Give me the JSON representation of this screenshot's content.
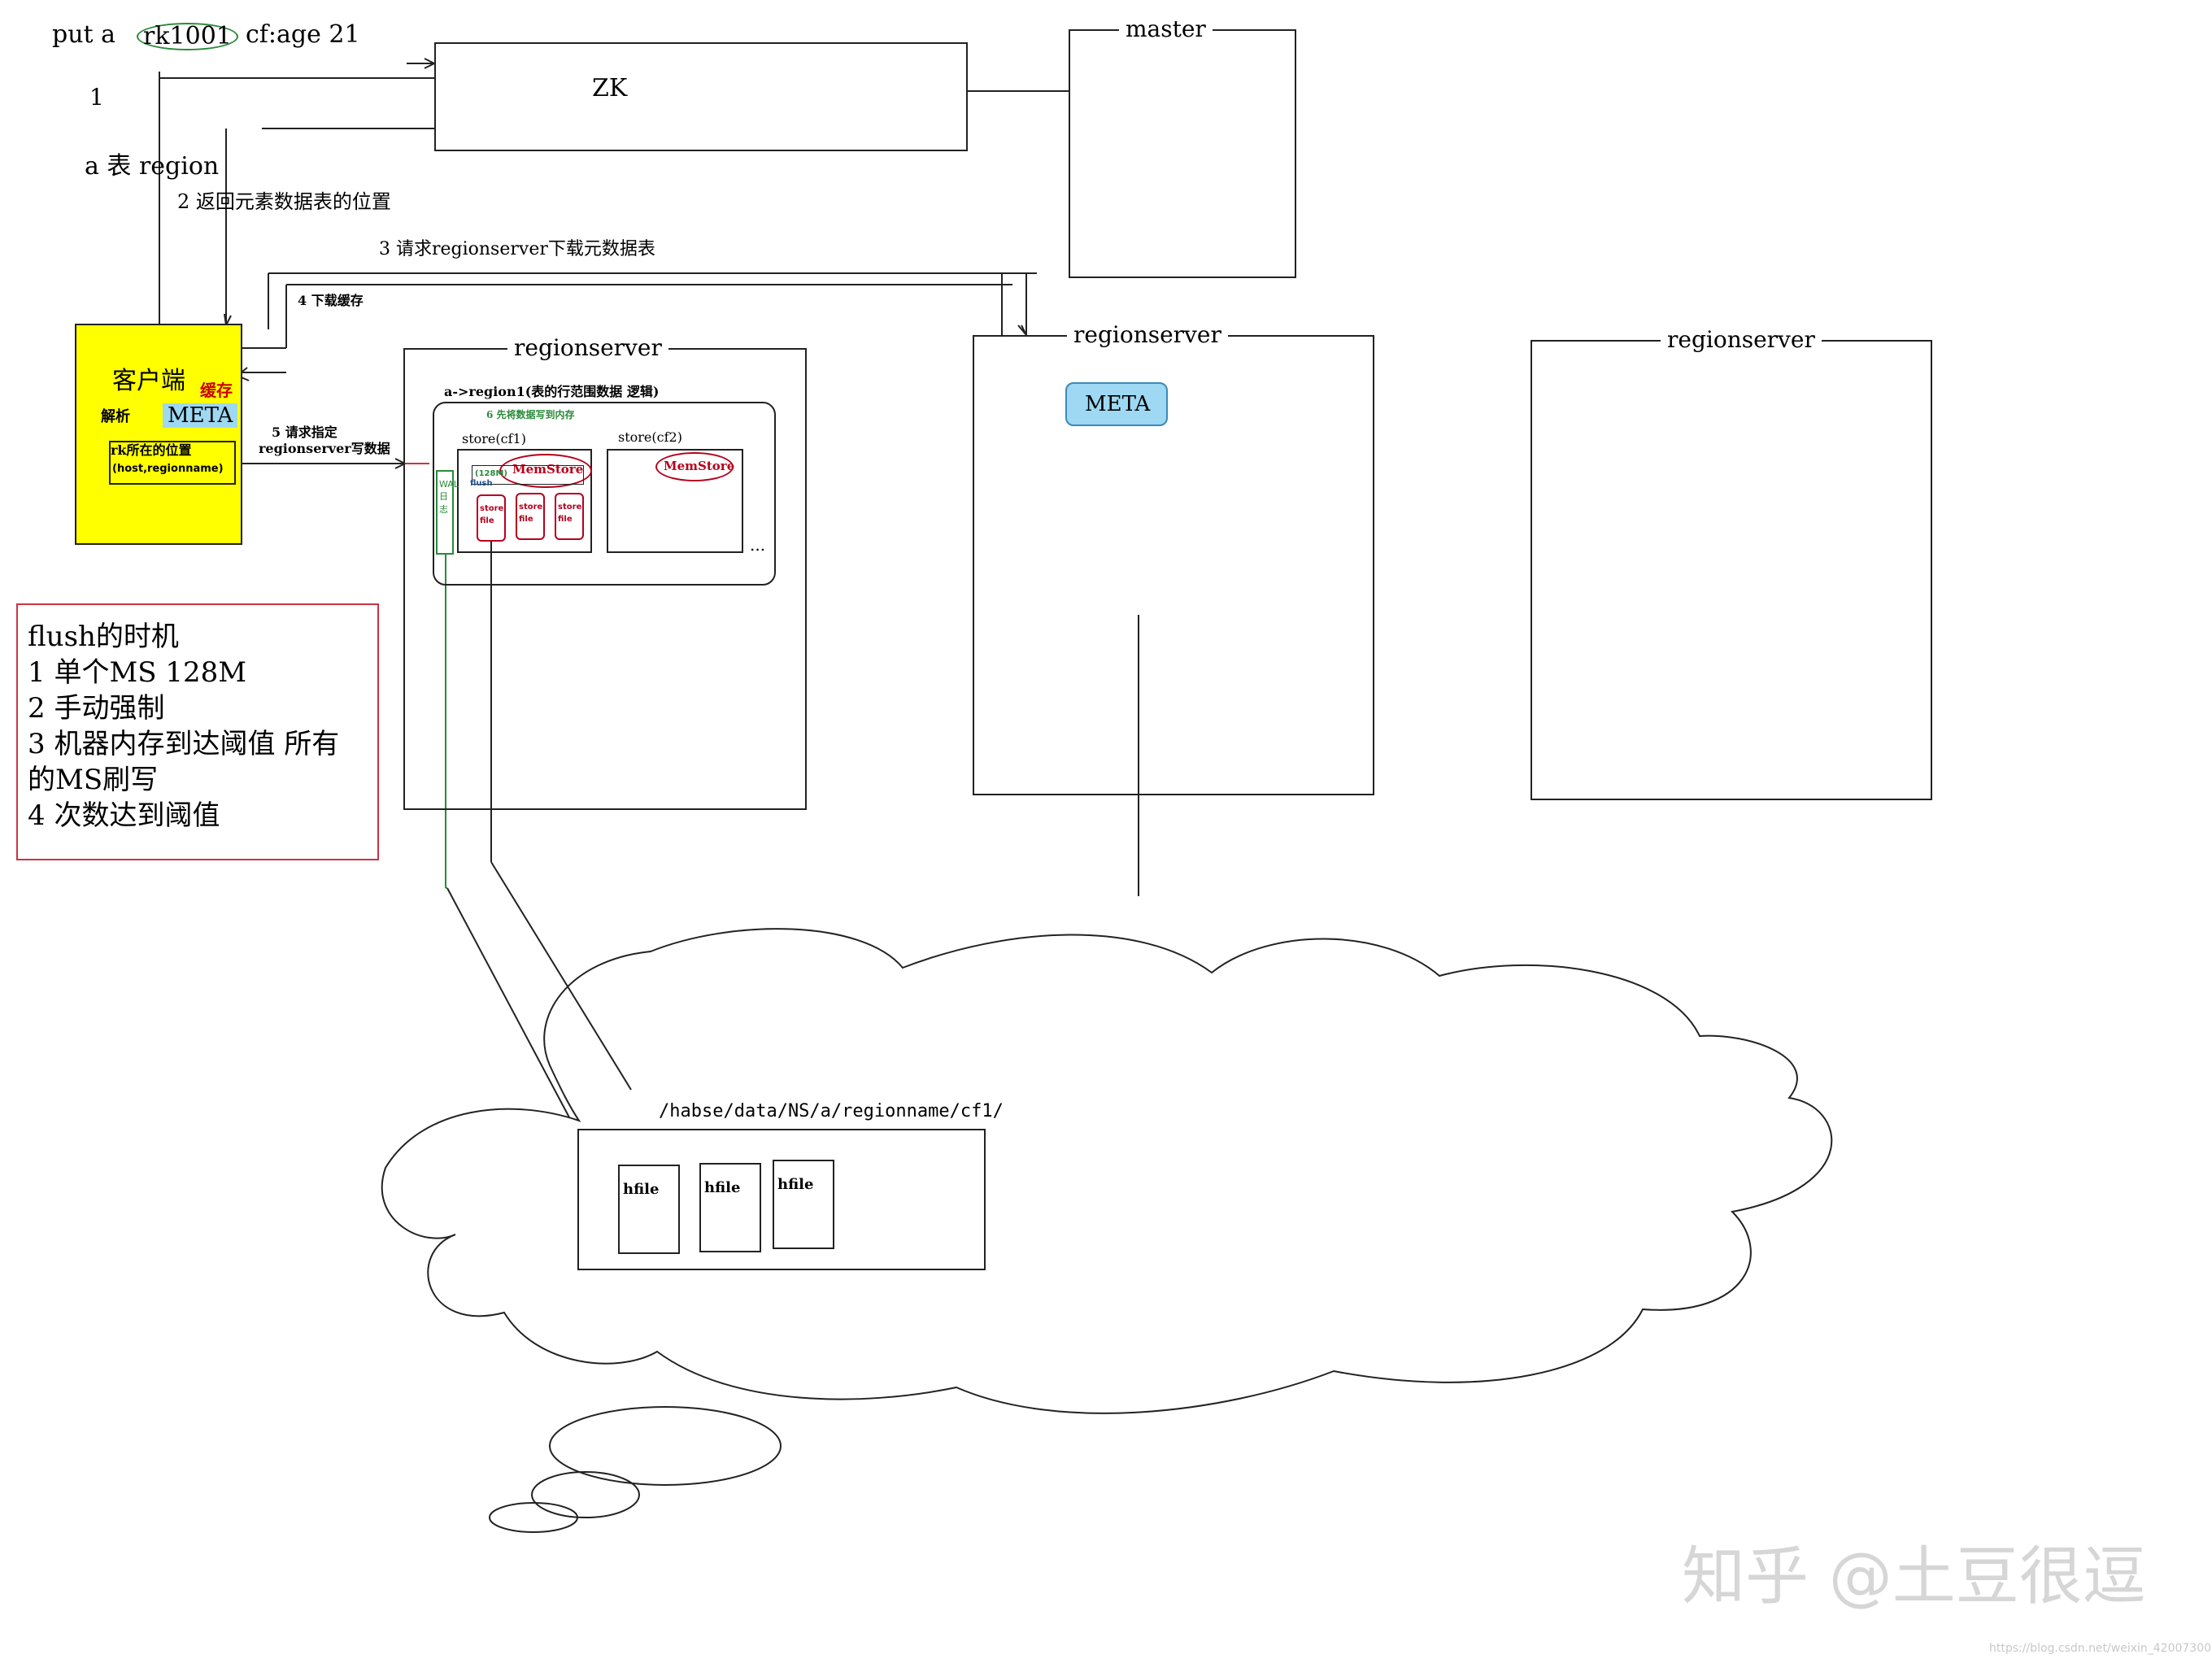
{
  "cmd": {
    "put": "put a",
    "rowkey": "rk1001",
    "rest": "cf:age 21"
  },
  "steps": {
    "s1": "1",
    "s1_caption": "a 表   region",
    "s2": "2 返回元素数据表的位置",
    "s3": "3 请求regionserver下载元数据表",
    "s4": "4 下载缓存",
    "s5_line1": "5 请求指定",
    "s5_line2": "regionserver写数据",
    "s6": "6 先将数据写到内存"
  },
  "zk": {
    "label": "ZK"
  },
  "master": {
    "label": "master"
  },
  "client": {
    "title": "客户端",
    "cache": "缓存",
    "parse": "解析",
    "meta": "META",
    "rk_line1": "rk所在的位置",
    "rk_line2": "(host,regionname)",
    "fill": "#ffff00"
  },
  "flush_box": {
    "title": "flush的时机",
    "l1": "1 单个MS 128M",
    "l2": "2 手动强制",
    "l3": "3 机器内存到达阈值 所有",
    "l4": "的MS刷写",
    "l5": "4 次数达到阈值"
  },
  "rs1": {
    "title": "regionserver",
    "region_label": "a->region1(表的行范围数据 逻辑)",
    "store1": "store(cf1)",
    "store2": "store(cf2)",
    "memstore1": "MemStore",
    "memstore2": "MemStore",
    "size": "(128M)",
    "flush": "flush",
    "wal": "WAL日志",
    "storefile": "store file",
    "ellipsis": "..."
  },
  "rs2": {
    "title": "regionserver",
    "meta": "META"
  },
  "rs3": {
    "title": "regionserver"
  },
  "hdfs": {
    "path": "/habse/data/NS/a/regionname/cf1/",
    "hfile": "hfile"
  },
  "watermark": "知乎 @土豆很逗",
  "url": "https://blog.csdn.net/weixin_42007300",
  "colors": {
    "red": "#cc0000",
    "green": "#2a8a3a",
    "memstore": "#b5001c",
    "meta_fill": "#9ed8f2",
    "pink": "#cc3344"
  }
}
